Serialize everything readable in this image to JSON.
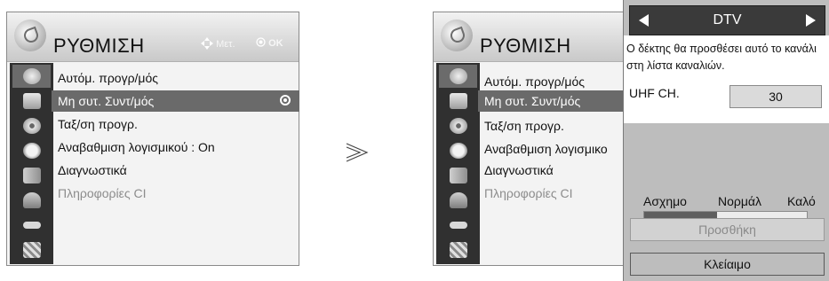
{
  "panel": {
    "title": "ΡΥΘΜΙΣΗ",
    "hint_move": "Μετ.",
    "hint_ok": "OK",
    "items": [
      {
        "label": "Αυτόμ. προγρ/μός"
      },
      {
        "label": "Μη συτ. Συντ/μός"
      },
      {
        "label": "Ταξ/ση προγρ."
      },
      {
        "label": "Αναβαθμιση λογισμικού  : On"
      },
      {
        "label": "Διαγνωστικά"
      },
      {
        "label": "Πληροφορίες CI"
      }
    ]
  },
  "panel_right": {
    "title": "ΡΥΘΜΙΣΗ",
    "items": [
      {
        "label": "Αυτόμ. προγρ/μός"
      },
      {
        "label": "Μη συτ. Συντ/μός"
      },
      {
        "label": "Ταξ/ση προγρ."
      },
      {
        "label": "Αναβαθμιση λογισμικο"
      },
      {
        "label": "Διαγνωστικά"
      },
      {
        "label": "Πληροφορίες CI"
      }
    ]
  },
  "dialog": {
    "mode": "DTV",
    "message": "Ο δέκτης θα προσθέσει αυτό το κανάλι στη λίστα καναλιών.",
    "uhf_label": "UHF CH.",
    "uhf_value": "30",
    "quality_labels": [
      "Ασχημο",
      "Νορμάλ",
      "Καλό"
    ],
    "quality_level": 0.45,
    "add_button": "Προσθήκη",
    "close_button": "Κλείαιμο"
  },
  "colors": {
    "highlight": "#6a6a6a",
    "icon_column": "#303030",
    "dialog_bg": "#bdbdbd"
  },
  "icons": [
    "satellite-icon",
    "tv-icon",
    "disc-icon",
    "clock-icon",
    "lock-icon",
    "padlock-icon",
    "cable-icon",
    "clapper-icon"
  ]
}
